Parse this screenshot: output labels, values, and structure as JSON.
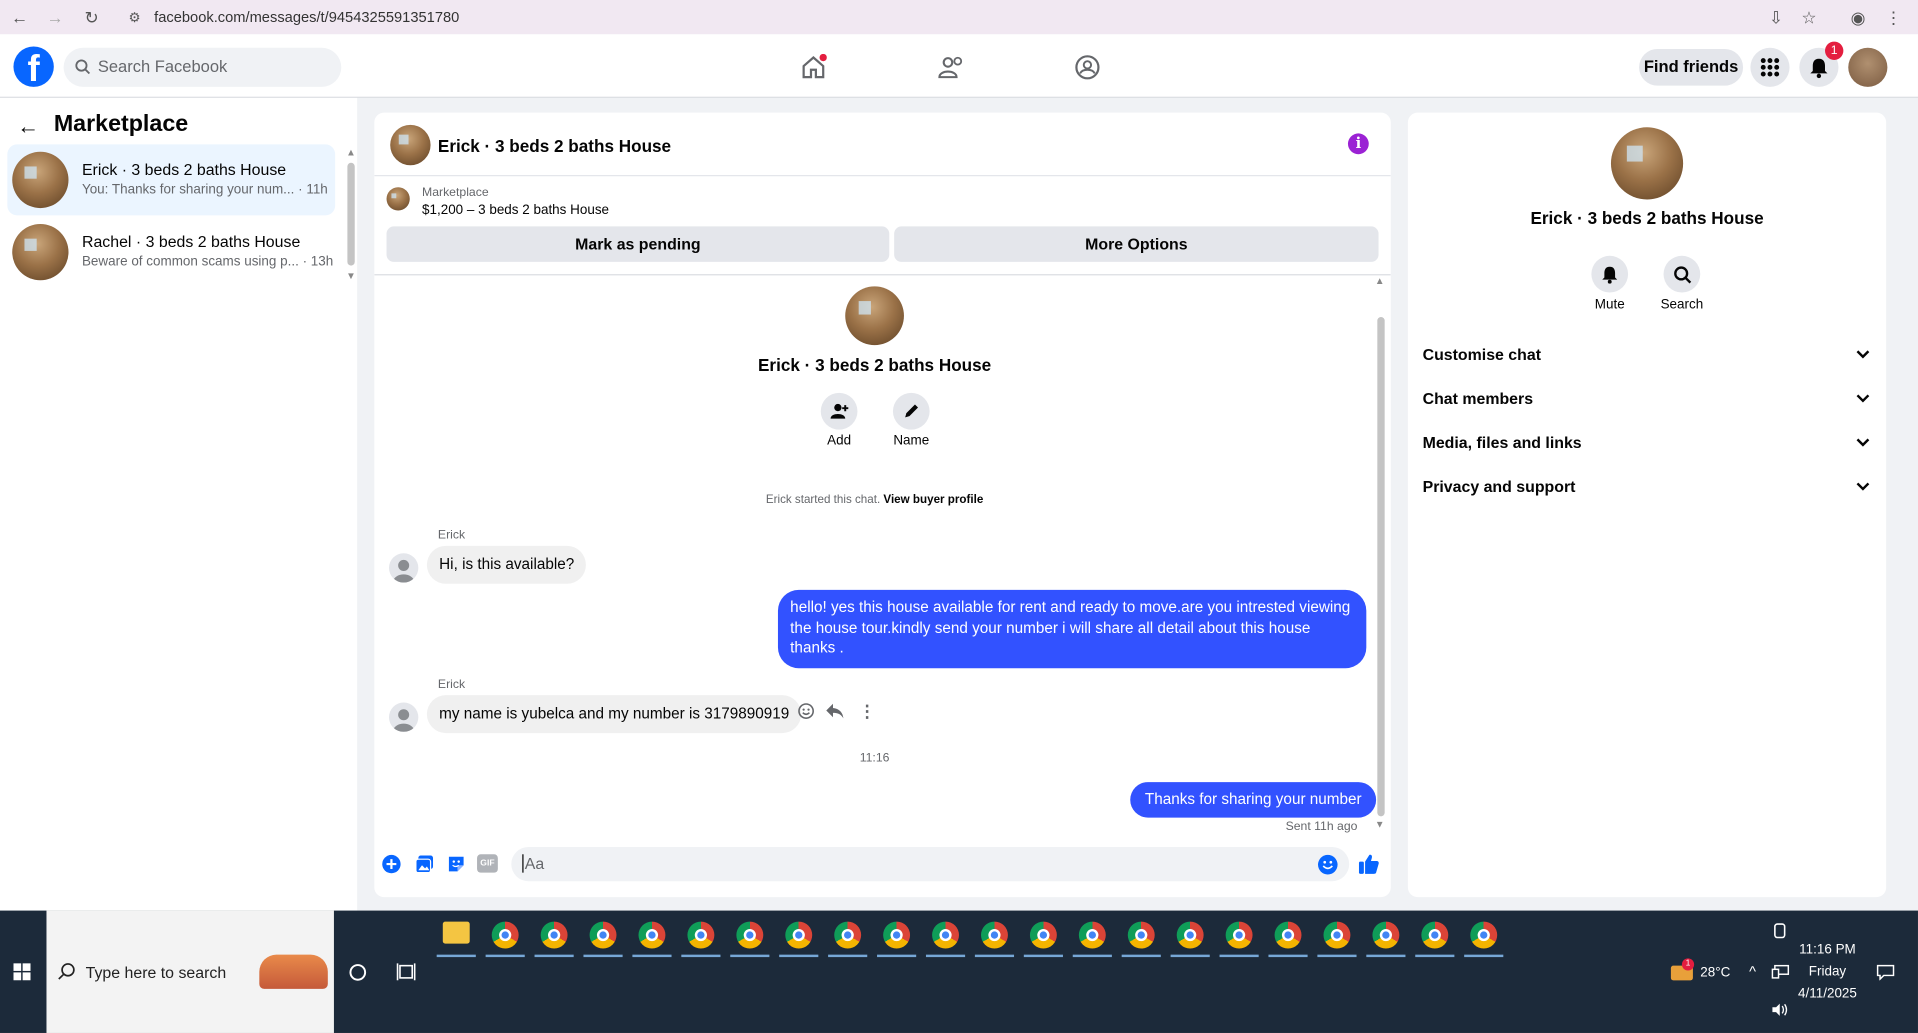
{
  "browser": {
    "url": "facebook.com/messages/t/9454325591351780"
  },
  "header": {
    "search_placeholder": "Search Facebook",
    "find_friends": "Find friends",
    "notification_count": "1",
    "logo_letter": "f"
  },
  "sidebar": {
    "title": "Marketplace",
    "conversations": [
      {
        "name": "Erick · 3 beds 2 baths House",
        "preview": "You: Thanks for sharing your num...",
        "time": "· 11h"
      },
      {
        "name": "Rachel · 3 beds 2 baths House",
        "preview": "Beware of common scams using p...",
        "time": "· 13h"
      }
    ]
  },
  "chat": {
    "title": "Erick · 3 beds 2 baths House",
    "info_icon": "i",
    "marketplace_label": "Marketplace",
    "listing": "$1,200 – 3 beds 2 baths House",
    "mark_pending": "Mark as pending",
    "more_options": "More Options",
    "profile_name": "Erick · 3 beds 2 baths House",
    "add_label": "Add",
    "name_label": "Name",
    "started_text": "Erick started this chat.",
    "view_buyer_profile": "View buyer profile",
    "messages": [
      {
        "sender": "Erick",
        "text": "Hi, is this available?"
      },
      {
        "sender": "me",
        "text": "hello! yes this house available for rent and ready to move.are you intrested viewing the house tour.kindly send your number i will share all detail about this house thanks ."
      },
      {
        "sender": "Erick",
        "text": "my name is yubelca and my number is 3179890919"
      },
      {
        "sender": "me",
        "text": "Thanks for sharing your number"
      }
    ],
    "timestamp": "11:16",
    "sent_status": "Sent 11h ago",
    "composer_placeholder": "Aa",
    "gif_label": "GIF"
  },
  "right_panel": {
    "name": "Erick · 3 beds 2 baths House",
    "mute_label": "Mute",
    "search_label": "Search",
    "sections": [
      "Customise chat",
      "Chat members",
      "Media, files and links",
      "Privacy and support"
    ]
  },
  "taskbar": {
    "search_placeholder": "Type here to search",
    "weather": "28°C",
    "weather_badge": "1",
    "time": "11:16 PM",
    "day": "Friday",
    "date": "4/11/2025"
  },
  "colors": {
    "brand_blue": "#0866ff",
    "outgoing_bubble": "#3252ff",
    "badge_red": "#e41e3f",
    "info_purple": "#9b22d4",
    "taskbar": "#1c2a3a"
  }
}
